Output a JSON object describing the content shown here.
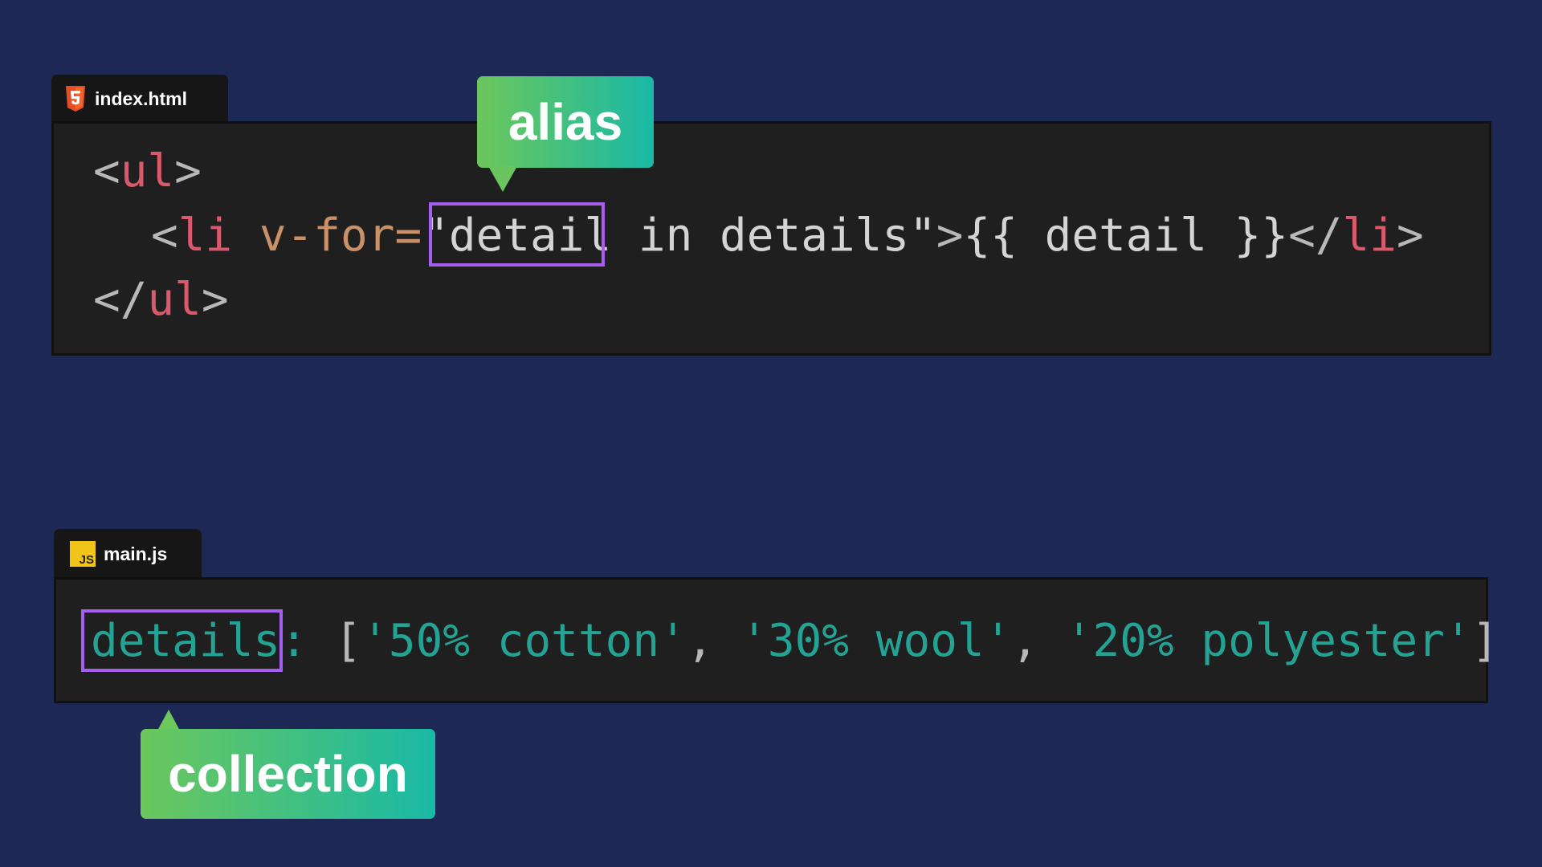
{
  "files": {
    "html_tab": {
      "filename": "index.html",
      "icon": "html5-icon"
    },
    "js_tab": {
      "filename": "main.js",
      "icon": "js-icon",
      "icon_text": "JS"
    }
  },
  "html_code": {
    "line1": {
      "open": "<",
      "tag": "ul",
      "close": ">"
    },
    "line2": {
      "open": "<",
      "tag": "li",
      "attr": " v-for=",
      "quote_open": "\"",
      "alias": "detail",
      "rest": " in details",
      "quote_close": "\"",
      "gt": ">",
      "interp": "{{ detail }}",
      "end_open": "</",
      "end_tag": "li",
      "end_close": ">"
    },
    "line3": {
      "open": "</",
      "tag": "ul",
      "close": ">"
    }
  },
  "js_code": {
    "key": "details",
    "colon": ":",
    "bracket_open": " [",
    "item1": "'50% cotton'",
    "sep1": ", ",
    "item2": "'30% wool'",
    "sep2": ", ",
    "item3": "'20% polyester'",
    "bracket_close": "]"
  },
  "callouts": {
    "alias": "alias",
    "collection": "collection"
  },
  "colors": {
    "background": "#1d2854",
    "code_background": "#1f1f1f",
    "tag": "#d9596d",
    "attribute": "#c8916a",
    "string": "#24a394",
    "highlight_box": "#a45ef0",
    "callout_gradient_start": "#6cc75c",
    "callout_gradient_end": "#19b9a6"
  }
}
